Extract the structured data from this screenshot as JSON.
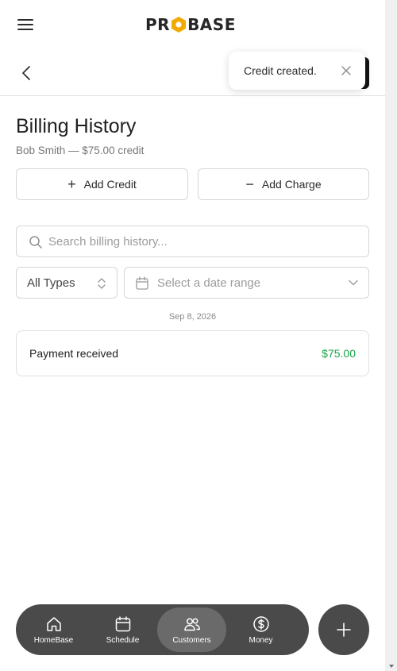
{
  "brand": {
    "logo_left": "PR",
    "logo_right": "BASE"
  },
  "toast": {
    "message": "Credit created."
  },
  "page": {
    "title": "Billing History",
    "subtitle": "Bob Smith — $75.00 credit"
  },
  "actions": {
    "add_credit_symbol": "+",
    "add_credit": "Add Credit",
    "add_charge_symbol": "−",
    "add_charge": "Add Charge"
  },
  "search": {
    "placeholder": "Search billing history..."
  },
  "filters": {
    "type_selected": "All Types",
    "date_placeholder": "Select a date range"
  },
  "history": {
    "groups": [
      {
        "date": "Sep 8, 2026",
        "items": [
          {
            "description": "Payment received",
            "amount": "$75.00",
            "amount_color": "#18a347"
          }
        ]
      }
    ]
  },
  "nav": {
    "items": [
      {
        "label": "HomeBase",
        "icon": "home-icon"
      },
      {
        "label": "Schedule",
        "icon": "calendar-icon"
      },
      {
        "label": "Customers",
        "icon": "customers-icon",
        "active": true
      },
      {
        "label": "Money",
        "icon": "dollar-icon"
      }
    ],
    "fab_icon": "plus-icon"
  },
  "colors": {
    "accent": "#f2a900",
    "credit_green": "#18a347",
    "nav_bg": "#4a4a4a"
  }
}
